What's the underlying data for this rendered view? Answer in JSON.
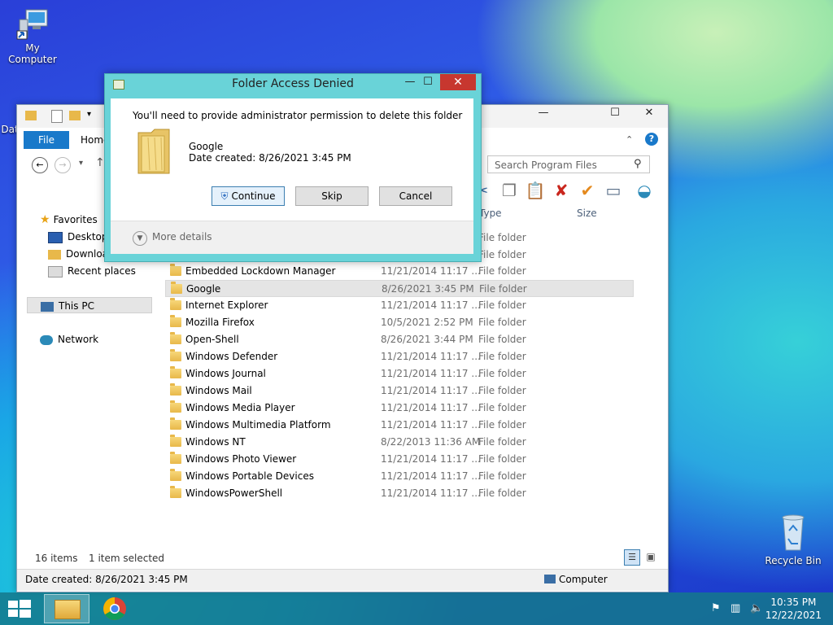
{
  "desktop": {
    "icons": [
      {
        "label": "My Computer",
        "icon": "computer-icon"
      },
      {
        "label": "Dat",
        "icon": "folder-icon"
      },
      {
        "label": "Recycle Bin",
        "icon": "recycle-bin-icon"
      }
    ]
  },
  "explorer": {
    "ribbon": {
      "file_label": "File",
      "home_label": "Home"
    },
    "search_placeholder": "Search Program Files",
    "columns": {
      "type": "Type",
      "size": "Size"
    },
    "sidebar": {
      "favorites": "Favorites",
      "desktop": "Desktop",
      "downloads": "Downloa",
      "recent": "Recent places",
      "this_pc": "This PC",
      "network": "Network"
    },
    "hidden_rows_type": [
      "File folder",
      "File folder"
    ],
    "files": [
      {
        "name": "Embedded Lockdown Manager",
        "date": "11/21/2014 11:17 ...",
        "type": "File folder"
      },
      {
        "name": "Google",
        "date": "8/26/2021 3:45 PM",
        "type": "File folder",
        "selected": true
      },
      {
        "name": "Internet Explorer",
        "date": "11/21/2014 11:17 ...",
        "type": "File folder"
      },
      {
        "name": "Mozilla Firefox",
        "date": "10/5/2021 2:52 PM",
        "type": "File folder"
      },
      {
        "name": "Open-Shell",
        "date": "8/26/2021 3:44 PM",
        "type": "File folder"
      },
      {
        "name": "Windows Defender",
        "date": "11/21/2014 11:17 ...",
        "type": "File folder"
      },
      {
        "name": "Windows Journal",
        "date": "11/21/2014 11:17 ...",
        "type": "File folder"
      },
      {
        "name": "Windows Mail",
        "date": "11/21/2014 11:17 ...",
        "type": "File folder"
      },
      {
        "name": "Windows Media Player",
        "date": "11/21/2014 11:17 ...",
        "type": "File folder"
      },
      {
        "name": "Windows Multimedia Platform",
        "date": "11/21/2014 11:17 ...",
        "type": "File folder"
      },
      {
        "name": "Windows NT",
        "date": "8/22/2013 11:36 AM",
        "type": "File folder"
      },
      {
        "name": "Windows Photo Viewer",
        "date": "11/21/2014 11:17 ...",
        "type": "File folder"
      },
      {
        "name": "Windows Portable Devices",
        "date": "11/21/2014 11:17 ...",
        "type": "File folder"
      },
      {
        "name": "WindowsPowerShell",
        "date": "11/21/2014 11:17 ...",
        "type": "File folder"
      }
    ],
    "status": {
      "count": "16 items",
      "selected": "1 item selected"
    },
    "bottom": {
      "date_created": "Date created: 8/26/2021 3:45 PM",
      "location": "Computer"
    }
  },
  "dialog": {
    "title": "Folder Access Denied",
    "message": "You'll need to provide administrator permission to delete this folder",
    "folder_name": "Google",
    "folder_date": "Date created: 8/26/2021 3:45 PM",
    "buttons": {
      "continue": "Continue",
      "skip": "Skip",
      "cancel": "Cancel"
    },
    "more_details": "More details"
  },
  "taskbar": {
    "time": "10:35 PM",
    "date": "12/22/2021"
  },
  "colors": {
    "accent": "#1979ca",
    "dialog_frame": "#69d3d8",
    "close_red": "#c7372f"
  }
}
